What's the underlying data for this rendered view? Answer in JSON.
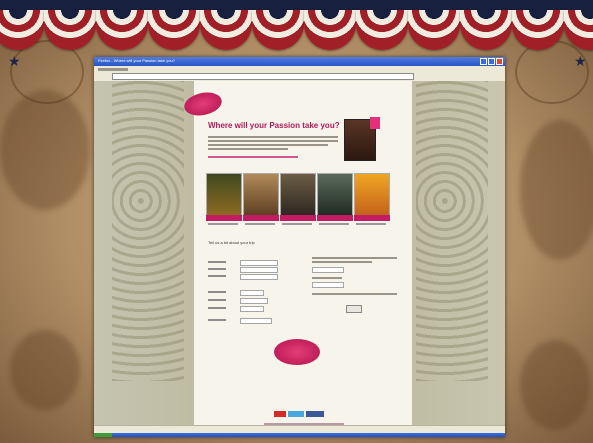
{
  "browser": {
    "window_title": "Firefox - Where will your Passion take you?",
    "page_heading": "Where will your Passion take you?"
  },
  "form": {
    "title": "Tell us a bit about your trip"
  },
  "colors": {
    "brand": "#b3195a",
    "bunting_red": "#a11f26",
    "bunting_navy": "#18203f",
    "xp_blue": "#2a55c4"
  },
  "icons": [
    "star-icon",
    "close-icon",
    "minimize-icon",
    "maximize-icon"
  ]
}
